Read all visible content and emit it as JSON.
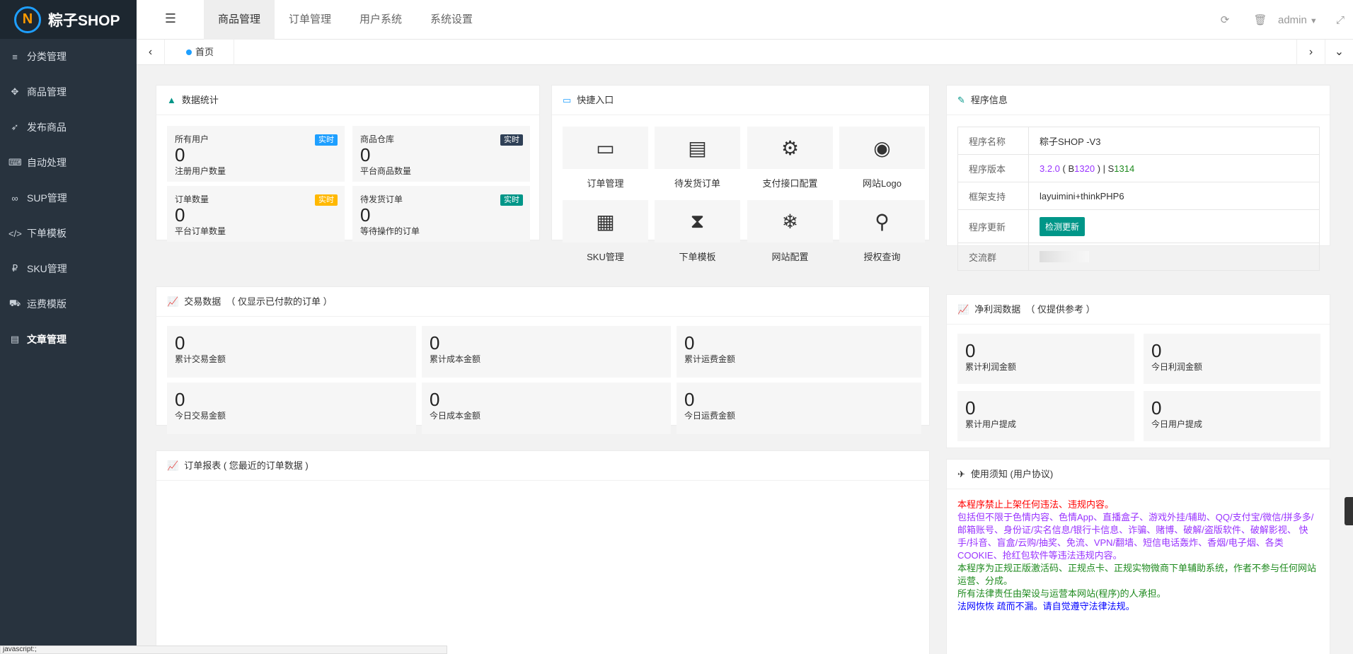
{
  "app": {
    "logo_text": "粽子SHOP",
    "logo_letter": "N"
  },
  "sidebar": {
    "items": [
      {
        "icon": "≡",
        "label": "分类管理"
      },
      {
        "icon": "✥",
        "label": "商品管理"
      },
      {
        "icon": "➶",
        "label": "发布商品"
      },
      {
        "icon": "⌨",
        "label": "自动处理"
      },
      {
        "icon": "∞",
        "label": "SUP管理"
      },
      {
        "icon": "</>",
        "label": "下单模板"
      },
      {
        "icon": "₽",
        "label": "SKU管理"
      },
      {
        "icon": "⛟",
        "label": "运费模版"
      },
      {
        "icon": "▤",
        "label": "文章管理"
      }
    ]
  },
  "header": {
    "tabs": [
      "商品管理",
      "订单管理",
      "用户系统",
      "系统设置"
    ],
    "user": "admin",
    "icons": {
      "refresh": "⟳",
      "trash": "🗑",
      "fullscreen": "⤢",
      "toggle": "☰"
    }
  },
  "tabbar": {
    "home": "首页"
  },
  "stats": {
    "title": "数据统计",
    "badge_label": "实时",
    "items": [
      {
        "title": "所有用户",
        "value": "0",
        "sub": "注册用户数量",
        "badge_color": "#1e9fff"
      },
      {
        "title": "商品仓库",
        "value": "0",
        "sub": "平台商品数量",
        "badge_color": "#2f4056"
      },
      {
        "title": "订单数量",
        "value": "0",
        "sub": "平台订单数量",
        "badge_color": "#ffb800"
      },
      {
        "title": "待发货订单",
        "value": "0",
        "sub": "等待操作的订单",
        "badge_color": "#009688"
      }
    ]
  },
  "quick": {
    "title": "快捷入口",
    "items": [
      {
        "icon": "▭",
        "label": "订单管理"
      },
      {
        "icon": "▤",
        "label": "待发货订单"
      },
      {
        "icon": "⚙",
        "label": "支付接口配置"
      },
      {
        "icon": "◉",
        "label": "网站Logo"
      },
      {
        "icon": "▦",
        "label": "SKU管理"
      },
      {
        "icon": "⧗",
        "label": "下单模板"
      },
      {
        "icon": "❄",
        "label": "网站配置"
      },
      {
        "icon": "⚲",
        "label": "授权查询"
      }
    ]
  },
  "program": {
    "title": "程序信息",
    "rows": {
      "name_k": "程序名称",
      "name_v": "粽子SHOP -V3",
      "ver_k": "程序版本",
      "ver_v1": "3.2.0",
      "ver_p1": " ( B",
      "ver_v2": "1320",
      "ver_p2": " ) | S",
      "ver_v3": "1314",
      "fw_k": "框架支持",
      "fw_v": "layuimini+thinkPHP6",
      "upd_k": "程序更新",
      "upd_btn": "检测更新",
      "group_k": "交流群"
    }
  },
  "trade": {
    "title": "交易数据",
    "subtitle": "（ 仅显示已付款的订单 ）",
    "items": [
      {
        "value": "0",
        "label": "累计交易金额"
      },
      {
        "value": "0",
        "label": "累计成本金额"
      },
      {
        "value": "0",
        "label": "累计运费金额"
      },
      {
        "value": "0",
        "label": "今日交易金额"
      },
      {
        "value": "0",
        "label": "今日成本金额"
      },
      {
        "value": "0",
        "label": "今日运费金额"
      }
    ]
  },
  "profit": {
    "title": "净利润数据",
    "subtitle": "（ 仅提供参考 ）",
    "items": [
      {
        "value": "0",
        "label": "累计利润金额"
      },
      {
        "value": "0",
        "label": "今日利润金额"
      },
      {
        "value": "0",
        "label": "累计用户提成"
      },
      {
        "value": "0",
        "label": "今日用户提成"
      }
    ]
  },
  "orders_report": {
    "title": "订单报表",
    "subtitle": "( 您最近的订单数据 )"
  },
  "notice": {
    "title": "使用须知 (用户协议)",
    "lines": [
      {
        "text": "本程序禁止上架任何违法、违规内容。",
        "color": "#ff0000"
      },
      {
        "text": "包括但不限于色情内容、色情App、直播盒子、游戏外挂/辅助、QQ/支付宝/微信/拼多多/邮箱账号、身份证/实名信息/银行卡信息、诈骗、赌博、破解/盗版软件、破解影视、 快手/抖音、盲盒/云购/抽奖、免流、VPN/翻墙、短信电话轰炸、香烟/电子烟、各类COOKIE、抢红包软件等违法违规内容。",
        "color": "#9933ff"
      },
      {
        "text": "本程序为正规正版激活码、正规点卡、正规实物微商下单辅助系统，作者不参与任何网站运营、分成。",
        "color": "#1e8a1e"
      },
      {
        "text": "所有法律责任由架设与运营本网站(程序)的人承担。",
        "color": "#1e8a1e"
      },
      {
        "text": "法网恢恢 疏而不漏。请自觉遵守法律法规。",
        "color": "#0000ff"
      }
    ]
  },
  "statusbar": {
    "text": "javascript:;"
  }
}
